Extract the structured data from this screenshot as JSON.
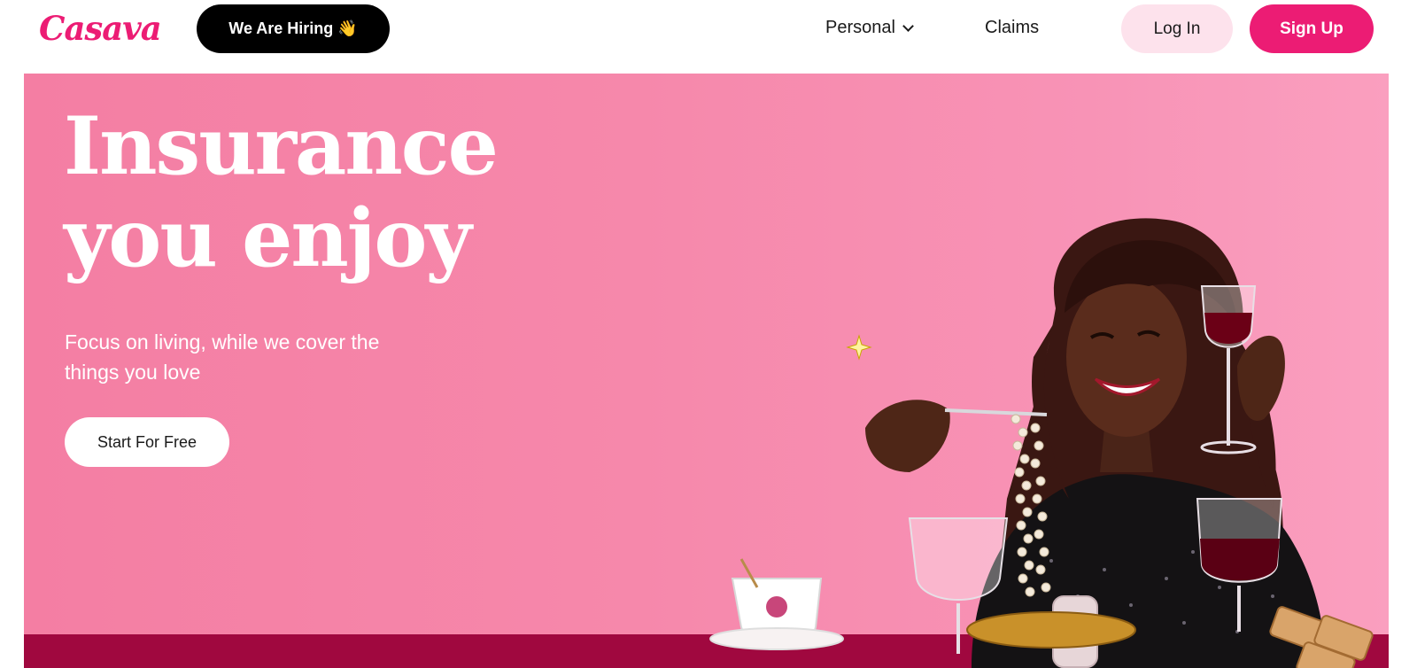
{
  "header": {
    "logo": "Casava",
    "hiring_label": "We Are Hiring 👋",
    "nav": {
      "personal": "Personal",
      "claims": "Claims"
    },
    "login_label": "Log In",
    "signup_label": "Sign Up"
  },
  "hero": {
    "headline_line1": "Insurance",
    "headline_line2": "you enjoy",
    "subtext": "Focus on living, while we cover the things you love",
    "cta_label": "Start For Free"
  },
  "colors": {
    "brand": "#ec1c74",
    "hero_bg": "#f688ab",
    "login_bg": "#fde2ec",
    "table_cloth": "#a0083f"
  },
  "icons": [
    "chevron-down-icon",
    "sparkle-icon"
  ]
}
